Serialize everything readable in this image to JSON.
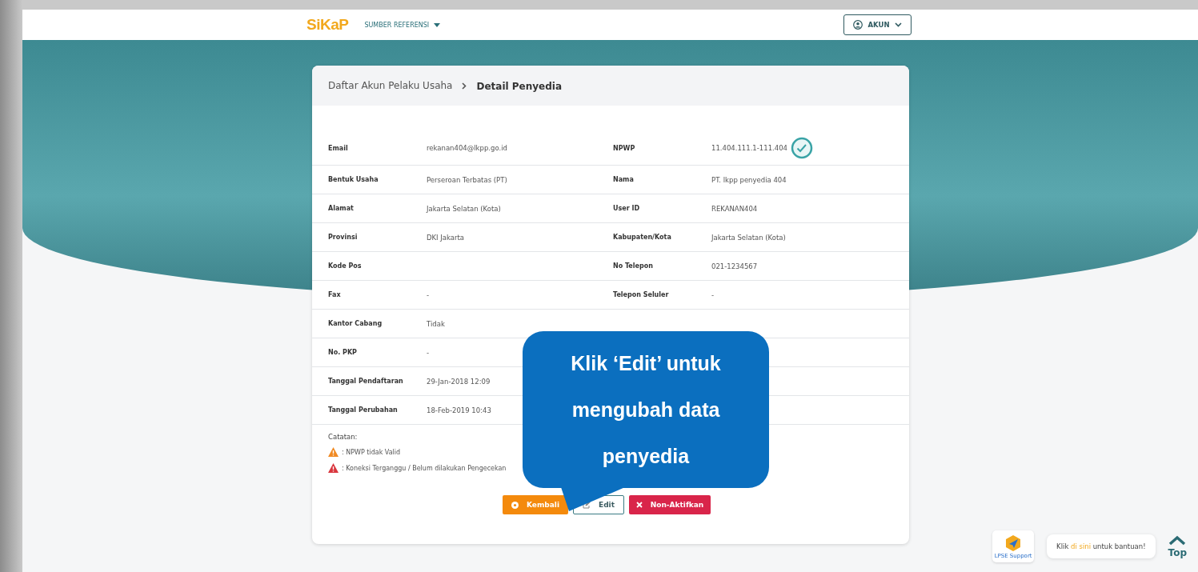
{
  "header": {
    "logo": "SiKaP",
    "nav": [
      {
        "label": "SUMBER REFERENSI"
      }
    ],
    "account": {
      "label": "AKUN"
    }
  },
  "breadcrumb": [
    {
      "label": "Daftar Akun Pelaku Usaha",
      "current": false
    },
    {
      "label": "Detail Penyedia",
      "current": true
    }
  ],
  "details": [
    {
      "label": "Email",
      "value": "rekanan404@lkpp.go.id",
      "label_2": "NPWP",
      "value_2": "11.404.111.1-111.404",
      "verified": true
    },
    {
      "label": "Bentuk Usaha",
      "value": "Perseroan Terbatas (PT)",
      "label_2": "Nama",
      "value_2": "PT. lkpp penyedia 404"
    },
    {
      "label": "Alamat",
      "value": "Jakarta Selatan (Kota)",
      "label_2": "User ID",
      "value_2": "REKANAN404"
    },
    {
      "label": "Provinsi",
      "value": "DKI Jakarta",
      "label_2": "Kabupaten/Kota",
      "value_2": "Jakarta Selatan (Kota)"
    },
    {
      "label": "Kode Pos",
      "label_2": "No Telepon",
      "value_2": "021-1234567"
    },
    {
      "label": "Fax",
      "value": "-",
      "label_2": "Telepon Seluler",
      "value_2": "-"
    },
    {
      "label": "Kantor Cabang",
      "value": "Tidak"
    },
    {
      "label": "No. PKP",
      "value": "-"
    },
    {
      "label": "Tanggal Pendaftaran",
      "value": "29-Jan-2018 12:09"
    },
    {
      "label": "Tanggal Perubahan",
      "value": "18-Feb-2019 10:43"
    }
  ],
  "notes": {
    "title": "Catatan:",
    "items": [
      {
        "text": ": NPWP tidak Valid",
        "color": "#f08a24"
      },
      {
        "text": ": Koneksi Terganggu / Belum dilakukan Pengecekan",
        "color": "#d9363e"
      }
    ]
  },
  "buttons": [
    {
      "kind": "back",
      "label": "Kembali"
    },
    {
      "kind": "edit",
      "label": "Edit"
    },
    {
      "kind": "deactivate",
      "label": "Non-Aktifkan"
    }
  ],
  "callout": {
    "lines": [
      "Klik ‘Edit’ untuk",
      "mengubah data",
      "penyedia"
    ]
  },
  "help": {
    "icon_label": "LPSE Support",
    "text_before": "Klik ",
    "link": "di sini",
    "text_after": " untuk bantuan!"
  },
  "top_button": {
    "label": "Top"
  }
}
